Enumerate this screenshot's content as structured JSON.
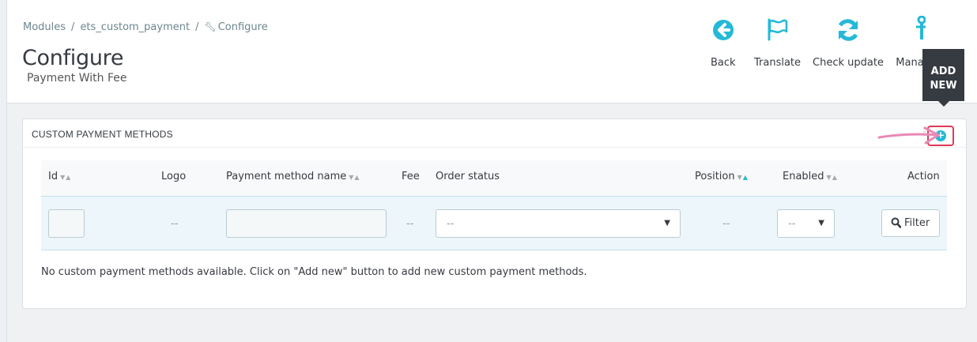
{
  "breadcrumb": {
    "items": [
      "Modules",
      "ets_custom_payment"
    ],
    "current": "Configure"
  },
  "header": {
    "title": "Configure",
    "subtitle": "Payment With Fee"
  },
  "toolbar": {
    "back": "Back",
    "translate": "Translate",
    "check_update": "Check update",
    "manage_hooks": "Mana",
    "tooltip": "ADD NEW"
  },
  "panel": {
    "title": "CUSTOM PAYMENT METHODS"
  },
  "table": {
    "columns": {
      "id": "Id",
      "logo": "Logo",
      "name": "Payment method name",
      "fee": "Fee",
      "order_status": "Order status",
      "position": "Position",
      "enabled": "Enabled",
      "action": "Action"
    },
    "filter": {
      "logo_placeholder": "--",
      "fee_placeholder": "--",
      "order_status_value": "--",
      "position_placeholder": "--",
      "enabled_value": "--",
      "filter_button": "Filter"
    },
    "empty_message": "No custom payment methods available. Click on \"Add new\" button to add new custom payment methods."
  },
  "colors": {
    "accent": "#25b9d7",
    "highlight": "#e0385b",
    "arrow": "#e889b5"
  },
  "icons": {
    "back": "circle-arrow-left-icon",
    "translate": "flag-icon",
    "check_update": "refresh-icon",
    "manage_hooks": "anchor-icon",
    "add_new": "plus-circle-icon",
    "filter": "search-icon"
  }
}
